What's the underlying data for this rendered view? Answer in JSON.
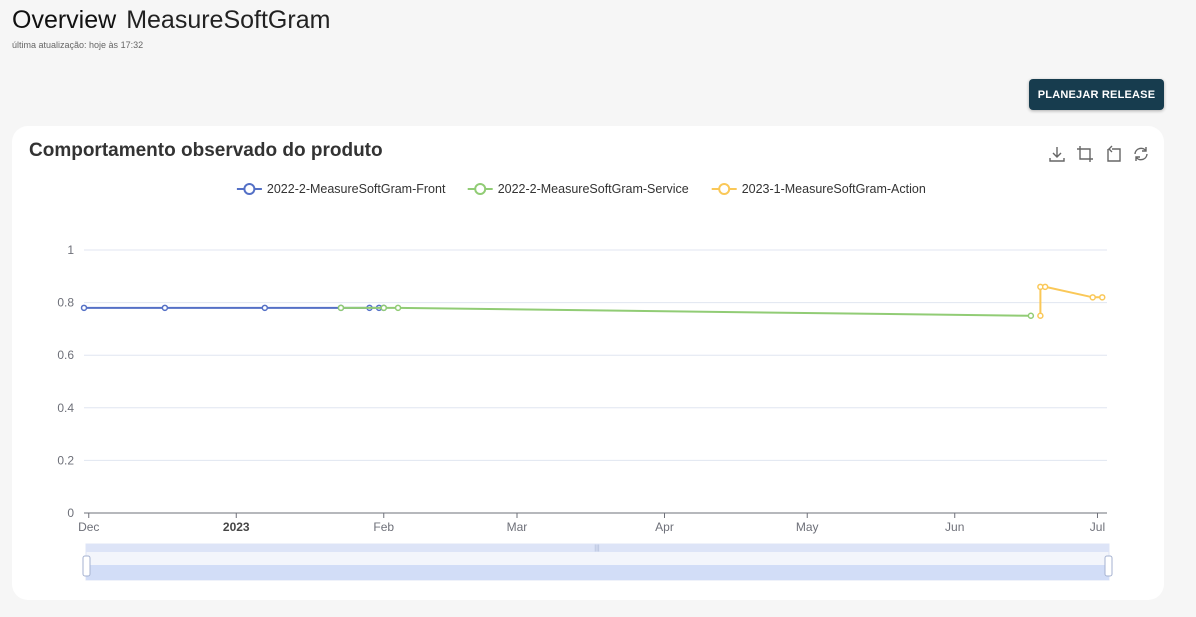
{
  "header": {
    "title": "Overview",
    "product": "MeasureSoftGram",
    "updated": "última atualização: hoje às 17:32"
  },
  "actions": {
    "plan_release": "PLANEJAR RELEASE"
  },
  "card": {
    "title": "Comportamento observado do produto",
    "tools": [
      "download-icon",
      "zoom-icon",
      "zoom-reset-icon",
      "restore-icon"
    ]
  },
  "chart_data": {
    "type": "line",
    "title": "Comportamento observado do produto",
    "xlabel": "",
    "ylabel": "",
    "x_ticks": [
      {
        "date": "2022-12-01",
        "label": "Dec",
        "bold": false
      },
      {
        "date": "2023-01-01",
        "label": "2023",
        "bold": true
      },
      {
        "date": "2023-02-01",
        "label": "Feb",
        "bold": false
      },
      {
        "date": "2023-03-01",
        "label": "Mar",
        "bold": false
      },
      {
        "date": "2023-04-01",
        "label": "Apr",
        "bold": false
      },
      {
        "date": "2023-05-01",
        "label": "May",
        "bold": false
      },
      {
        "date": "2023-06-01",
        "label": "Jun",
        "bold": false
      },
      {
        "date": "2023-07-01",
        "label": "Jul",
        "bold": false
      }
    ],
    "xlim": [
      "2022-11-30",
      "2023-07-03"
    ],
    "ylim": [
      0,
      1
    ],
    "y_ticks": [
      0,
      0.2,
      0.4,
      0.6,
      0.8,
      1
    ],
    "grid": true,
    "legend_position": "top-center",
    "datazoom_slider": true,
    "series": [
      {
        "name": "2022-2-MeasureSoftGram-Front",
        "color": "#5470c6",
        "points": [
          [
            "2022-11-30",
            0.78
          ],
          [
            "2022-12-17",
            0.78
          ],
          [
            "2023-01-07",
            0.78
          ],
          [
            "2023-01-23",
            0.78
          ],
          [
            "2023-01-29",
            0.78
          ],
          [
            "2023-01-31",
            0.78
          ],
          [
            "2023-02-01",
            0.78
          ]
        ]
      },
      {
        "name": "2022-2-MeasureSoftGram-Service",
        "color": "#91cc75",
        "points": [
          [
            "2023-01-23",
            0.78
          ],
          [
            "2023-02-01",
            0.78
          ],
          [
            "2023-02-04",
            0.78
          ],
          [
            "2023-06-17",
            0.75
          ]
        ]
      },
      {
        "name": "2023-1-MeasureSoftGram-Action",
        "color": "#fac858",
        "points": [
          [
            "2023-06-19",
            0.75
          ],
          [
            "2023-06-19",
            0.86
          ],
          [
            "2023-06-20",
            0.86
          ],
          [
            "2023-06-30",
            0.82
          ],
          [
            "2023-07-02",
            0.82
          ]
        ]
      }
    ]
  }
}
